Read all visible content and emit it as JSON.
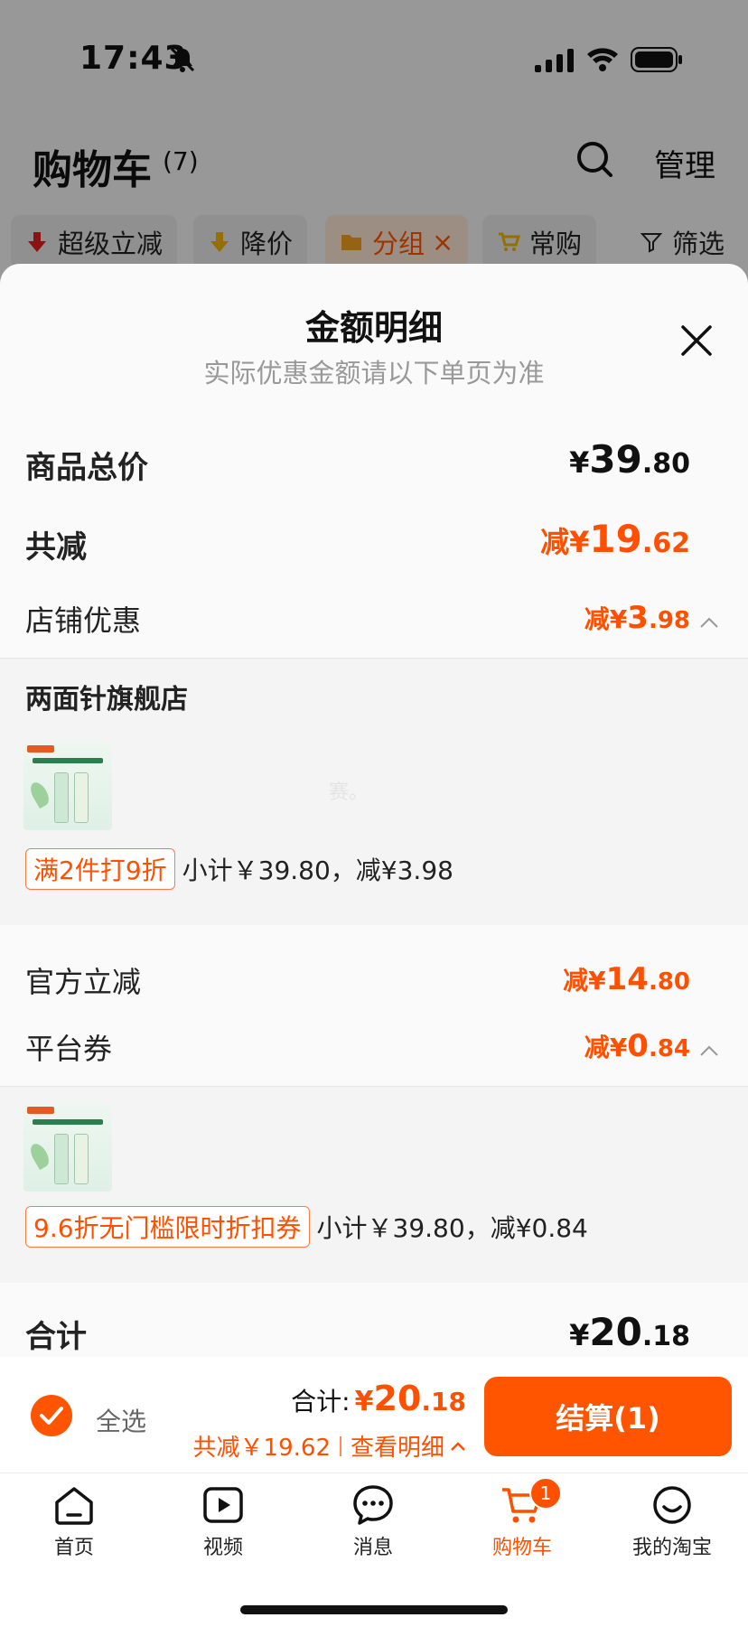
{
  "status_bar": {
    "time": "17:43"
  },
  "background_page": {
    "title": "购物车",
    "count": "(7)",
    "manage": "管理",
    "filters": [
      {
        "label": "超级立减",
        "icon": "arrow-down-icon",
        "color": "#e02020"
      },
      {
        "label": "降价",
        "icon": "arrow-down-icon",
        "color": "#f0b400"
      },
      {
        "label": "分组",
        "icon": "folder-icon",
        "active": true,
        "close": "×"
      },
      {
        "label": "常购",
        "icon": "cart-icon",
        "color": "#f0b400"
      },
      {
        "label": "筛选",
        "icon": "filter-icon"
      }
    ]
  },
  "sheet": {
    "title": "金额明细",
    "subtitle": "实际优惠金额请以下单页为准",
    "goods_total": {
      "label": "商品总价",
      "cur": "¥",
      "int": "39",
      "dec": ".80"
    },
    "total_reduction": {
      "label": "共减",
      "prefix": "减¥",
      "int": "19",
      "dec": ".62"
    },
    "store_discount": {
      "label": "店铺优惠",
      "prefix": "减¥",
      "int": "3",
      "dec": ".98"
    },
    "store_group": {
      "store_name": "两面针旗舰店",
      "watermark": "赛。",
      "promo_tag": "满2件打9折",
      "promo_text": "小计￥39.80，减¥3.98"
    },
    "official_reduction": {
      "label": "官方立减",
      "prefix": "减¥",
      "int": "14",
      "dec": ".80"
    },
    "platform_coupon": {
      "label": "平台券",
      "prefix": "减¥",
      "int": "0",
      "dec": ".84"
    },
    "coupon_group": {
      "promo_tag": "9.6折无门槛限时折扣券",
      "promo_text": "小计￥39.80，减¥0.84"
    },
    "grand_total": {
      "label": "合计",
      "cur": "¥",
      "int": "20",
      "dec": ".18"
    }
  },
  "checkout_bar": {
    "select_all": "全选",
    "total_label": "合计:",
    "total_cur": "¥",
    "total_int": "20",
    "total_dec": ".18",
    "saving_text": "共减￥19.62",
    "view_detail": "查看明细",
    "checkout_button": "结算(1)"
  },
  "tab_bar": {
    "tabs": [
      {
        "label": "首页",
        "icon": "home-icon"
      },
      {
        "label": "视频",
        "icon": "video-icon"
      },
      {
        "label": "消息",
        "icon": "message-icon"
      },
      {
        "label": "购物车",
        "icon": "cart-icon",
        "active": true,
        "badge": "1"
      },
      {
        "label": "我的淘宝",
        "icon": "profile-icon"
      }
    ]
  },
  "colors": {
    "accent": "#ff5000",
    "overlay": "rgba(0,0,0,0.38)"
  }
}
